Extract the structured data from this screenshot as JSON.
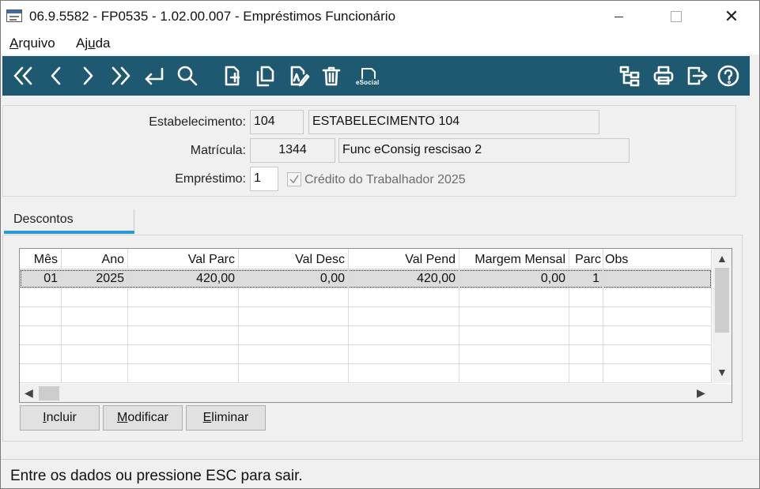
{
  "window": {
    "title": "06.9.5582 - FP0535 - 1.02.00.007 - Empréstimos Funcionário",
    "close_glyph": "✕"
  },
  "menu": {
    "arquivo_first": "A",
    "arquivo_rest": "rquivo",
    "ajuda_first": "Aj",
    "ajuda_u": "u",
    "ajuda_rest": "da"
  },
  "toolbar": {
    "esocial_label": "eSocial",
    "icons": [
      "first-icon",
      "previous-icon",
      "next-icon",
      "last-icon",
      "return-icon",
      "search-icon",
      "new-icon",
      "copy-icon",
      "edit-icon",
      "delete-icon",
      "esocial-icon",
      "tree-icon",
      "print-icon",
      "exit-icon",
      "help-icon"
    ]
  },
  "header": {
    "estabelecimento_label": "Estabelecimento:",
    "estabelecimento_code": "104",
    "estabelecimento_name": "ESTABELECIMENTO 104",
    "matricula_label": "Matrícula:",
    "matricula_code": "1344",
    "matricula_name": "Func  eConsig rescisao 2",
    "emprestimo_label": "Empréstimo:",
    "emprestimo_value": "1",
    "credito_label": "Crédito do Trabalhador 2025",
    "credito_checked": true
  },
  "tabs": [
    {
      "label": "Descontos",
      "active": true
    }
  ],
  "grid": {
    "columns": [
      "Mês",
      "Ano",
      "Val Parc",
      "Val Desc",
      "Val Pend",
      "Margem Mensal",
      "Parc",
      "Obs"
    ],
    "rows": [
      [
        "01",
        "2025",
        "420,00",
        "0,00",
        "420,00",
        "0,00",
        "1",
        ""
      ],
      [
        "",
        "",
        "",
        "",
        "",
        "",
        "",
        ""
      ],
      [
        "",
        "",
        "",
        "",
        "",
        "",
        "",
        ""
      ],
      [
        "",
        "",
        "",
        "",
        "",
        "",
        "",
        ""
      ],
      [
        "",
        "",
        "",
        "",
        "",
        "",
        "",
        ""
      ],
      [
        "",
        "",
        "",
        "",
        "",
        "",
        "",
        ""
      ]
    ]
  },
  "buttons": {
    "incluir_u": "I",
    "incluir_rest": "ncluir",
    "modificar_u": "M",
    "modificar_rest": "odificar",
    "eliminar_u": "E",
    "eliminar_rest": "liminar"
  },
  "status": {
    "text": "Entre os dados ou pressione ESC para sair."
  },
  "colors": {
    "toolbar_bg": "#1f5871",
    "tab_accent": "#2a99d6"
  }
}
